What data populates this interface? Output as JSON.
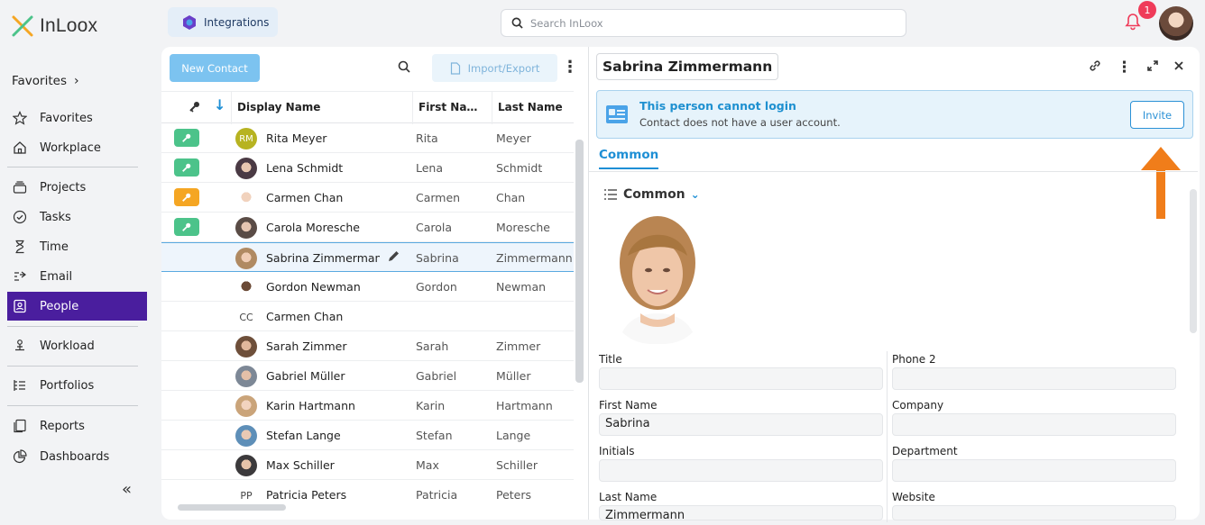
{
  "app": {
    "brand": "InLoox"
  },
  "top": {
    "integrations": "Integrations",
    "search_placeholder": "Search InLoox",
    "notif_count": "1"
  },
  "sidebar": {
    "favorites_header": "Favorites",
    "items": [
      {
        "label": "Favorites",
        "icon": "star-icon"
      },
      {
        "label": "Workplace",
        "icon": "home-icon"
      },
      {
        "label": "Projects",
        "icon": "projects-icon"
      },
      {
        "label": "Tasks",
        "icon": "check-circle-icon"
      },
      {
        "label": "Time",
        "icon": "hourglass-icon"
      },
      {
        "label": "Email",
        "icon": "email-icon"
      },
      {
        "label": "People",
        "icon": "contact-card-icon"
      },
      {
        "label": "Workload",
        "icon": "workload-icon"
      },
      {
        "label": "Portfolios",
        "icon": "portfolio-icon"
      },
      {
        "label": "Reports",
        "icon": "report-icon"
      },
      {
        "label": "Dashboards",
        "icon": "dashboard-icon"
      }
    ],
    "active": "People"
  },
  "list": {
    "new_contact": "New Contact",
    "import_export": "Import/Export",
    "columns": {
      "display": "Display Name",
      "first": "First Na…",
      "last": "Last Name"
    },
    "rows": [
      {
        "display": "Rita Meyer",
        "first": "Rita",
        "last": "Meyer",
        "key": "green",
        "initials": "RM"
      },
      {
        "display": "Lena Schmidt",
        "first": "Lena",
        "last": "Schmidt",
        "key": "green",
        "initials": ""
      },
      {
        "display": "Carmen Chan",
        "first": "Carmen",
        "last": "Chan",
        "key": "orange",
        "initials": ""
      },
      {
        "display": "Carola Moresche",
        "first": "Carola",
        "last": "Moresche",
        "key": "green",
        "initials": ""
      },
      {
        "display": "Sabrina Zimmermann",
        "first": "Sabrina",
        "last": "Zimmermann",
        "key": "",
        "initials": ""
      },
      {
        "display": "Gordon Newman",
        "first": "Gordon",
        "last": "Newman",
        "key": "",
        "initials": ""
      },
      {
        "display": "Carmen Chan",
        "first": "",
        "last": "",
        "key": "",
        "initials": "CC"
      },
      {
        "display": "Sarah Zimmer",
        "first": "Sarah",
        "last": "Zimmer",
        "key": "",
        "initials": ""
      },
      {
        "display": "Gabriel Müller",
        "first": "Gabriel",
        "last": "Müller",
        "key": "",
        "initials": ""
      },
      {
        "display": "Karin Hartmann",
        "first": "Karin",
        "last": "Hartmann",
        "key": "",
        "initials": ""
      },
      {
        "display": "Stefan Lange",
        "first": "Stefan",
        "last": "Lange",
        "key": "",
        "initials": ""
      },
      {
        "display": "Max Schiller",
        "first": "Max",
        "last": "Schiller",
        "key": "",
        "initials": ""
      },
      {
        "display": "Patricia Peters",
        "first": "Patricia",
        "last": "Peters",
        "key": "",
        "initials": "PP"
      }
    ]
  },
  "detail": {
    "name": "Sabrina Zimmermann",
    "banner_title": "This person cannot login",
    "banner_sub": "Contact does not have a user account.",
    "invite": "Invite",
    "tab": "Common",
    "section": "Common",
    "fields": {
      "title_label": "Title",
      "title_value": "",
      "phone2_label": "Phone 2",
      "phone2_value": "",
      "firstname_label": "First Name",
      "firstname_value": "Sabrina",
      "company_label": "Company",
      "company_value": "",
      "initials_label": "Initials",
      "initials_value": "",
      "department_label": "Department",
      "department_value": "",
      "lastname_label": "Last Name",
      "lastname_value": "Zimmermann",
      "website_label": "Website",
      "website_value": ""
    }
  },
  "colors": {
    "accent": "#4a1e9e",
    "key_green": "#4cc38a",
    "key_orange": "#f5a623",
    "link": "#1e8fd5",
    "arrow": "#f07d1a"
  }
}
